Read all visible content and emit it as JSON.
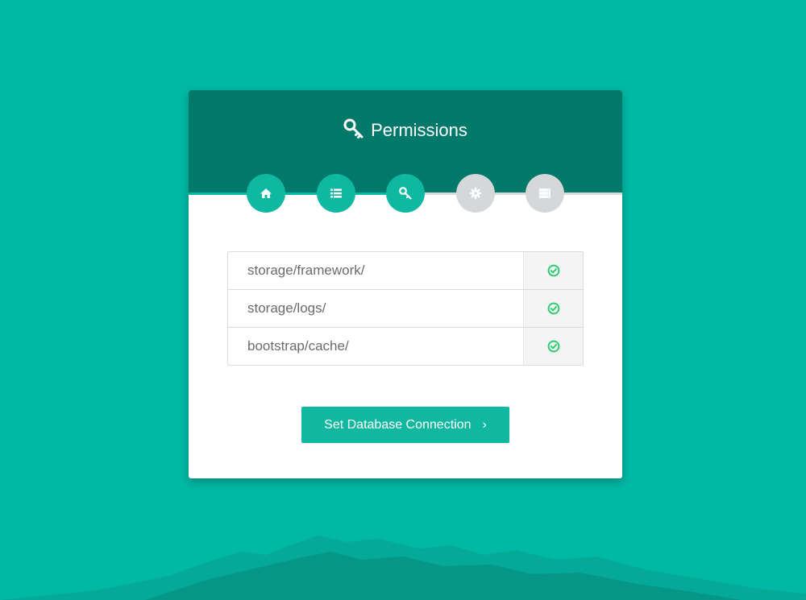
{
  "header": {
    "title": "Permissions",
    "title_icon": "key-icon"
  },
  "steps": [
    {
      "icon": "home-icon",
      "status": "complete"
    },
    {
      "icon": "list-icon",
      "status": "complete"
    },
    {
      "icon": "key-icon",
      "status": "current"
    },
    {
      "icon": "gear-icon",
      "status": "pending"
    },
    {
      "icon": "server-icon",
      "status": "pending"
    }
  ],
  "permissions": {
    "rows": [
      {
        "path": "storage/framework/",
        "status_icon": "check-circle-icon"
      },
      {
        "path": "storage/logs/",
        "status_icon": "check-circle-icon"
      },
      {
        "path": "bootstrap/cache/",
        "status_icon": "check-circle-icon"
      }
    ]
  },
  "actions": {
    "next_label": "Set Database Connection",
    "next_icon": "chevron-right-icon",
    "next_chevron": "›"
  },
  "colors": {
    "background": "#00b9a4",
    "header": "#00796b",
    "step_done": "#0fb9a1",
    "step_pending": "#d5d7d9",
    "check": "#2ecc71",
    "button": "#11b8a0"
  }
}
